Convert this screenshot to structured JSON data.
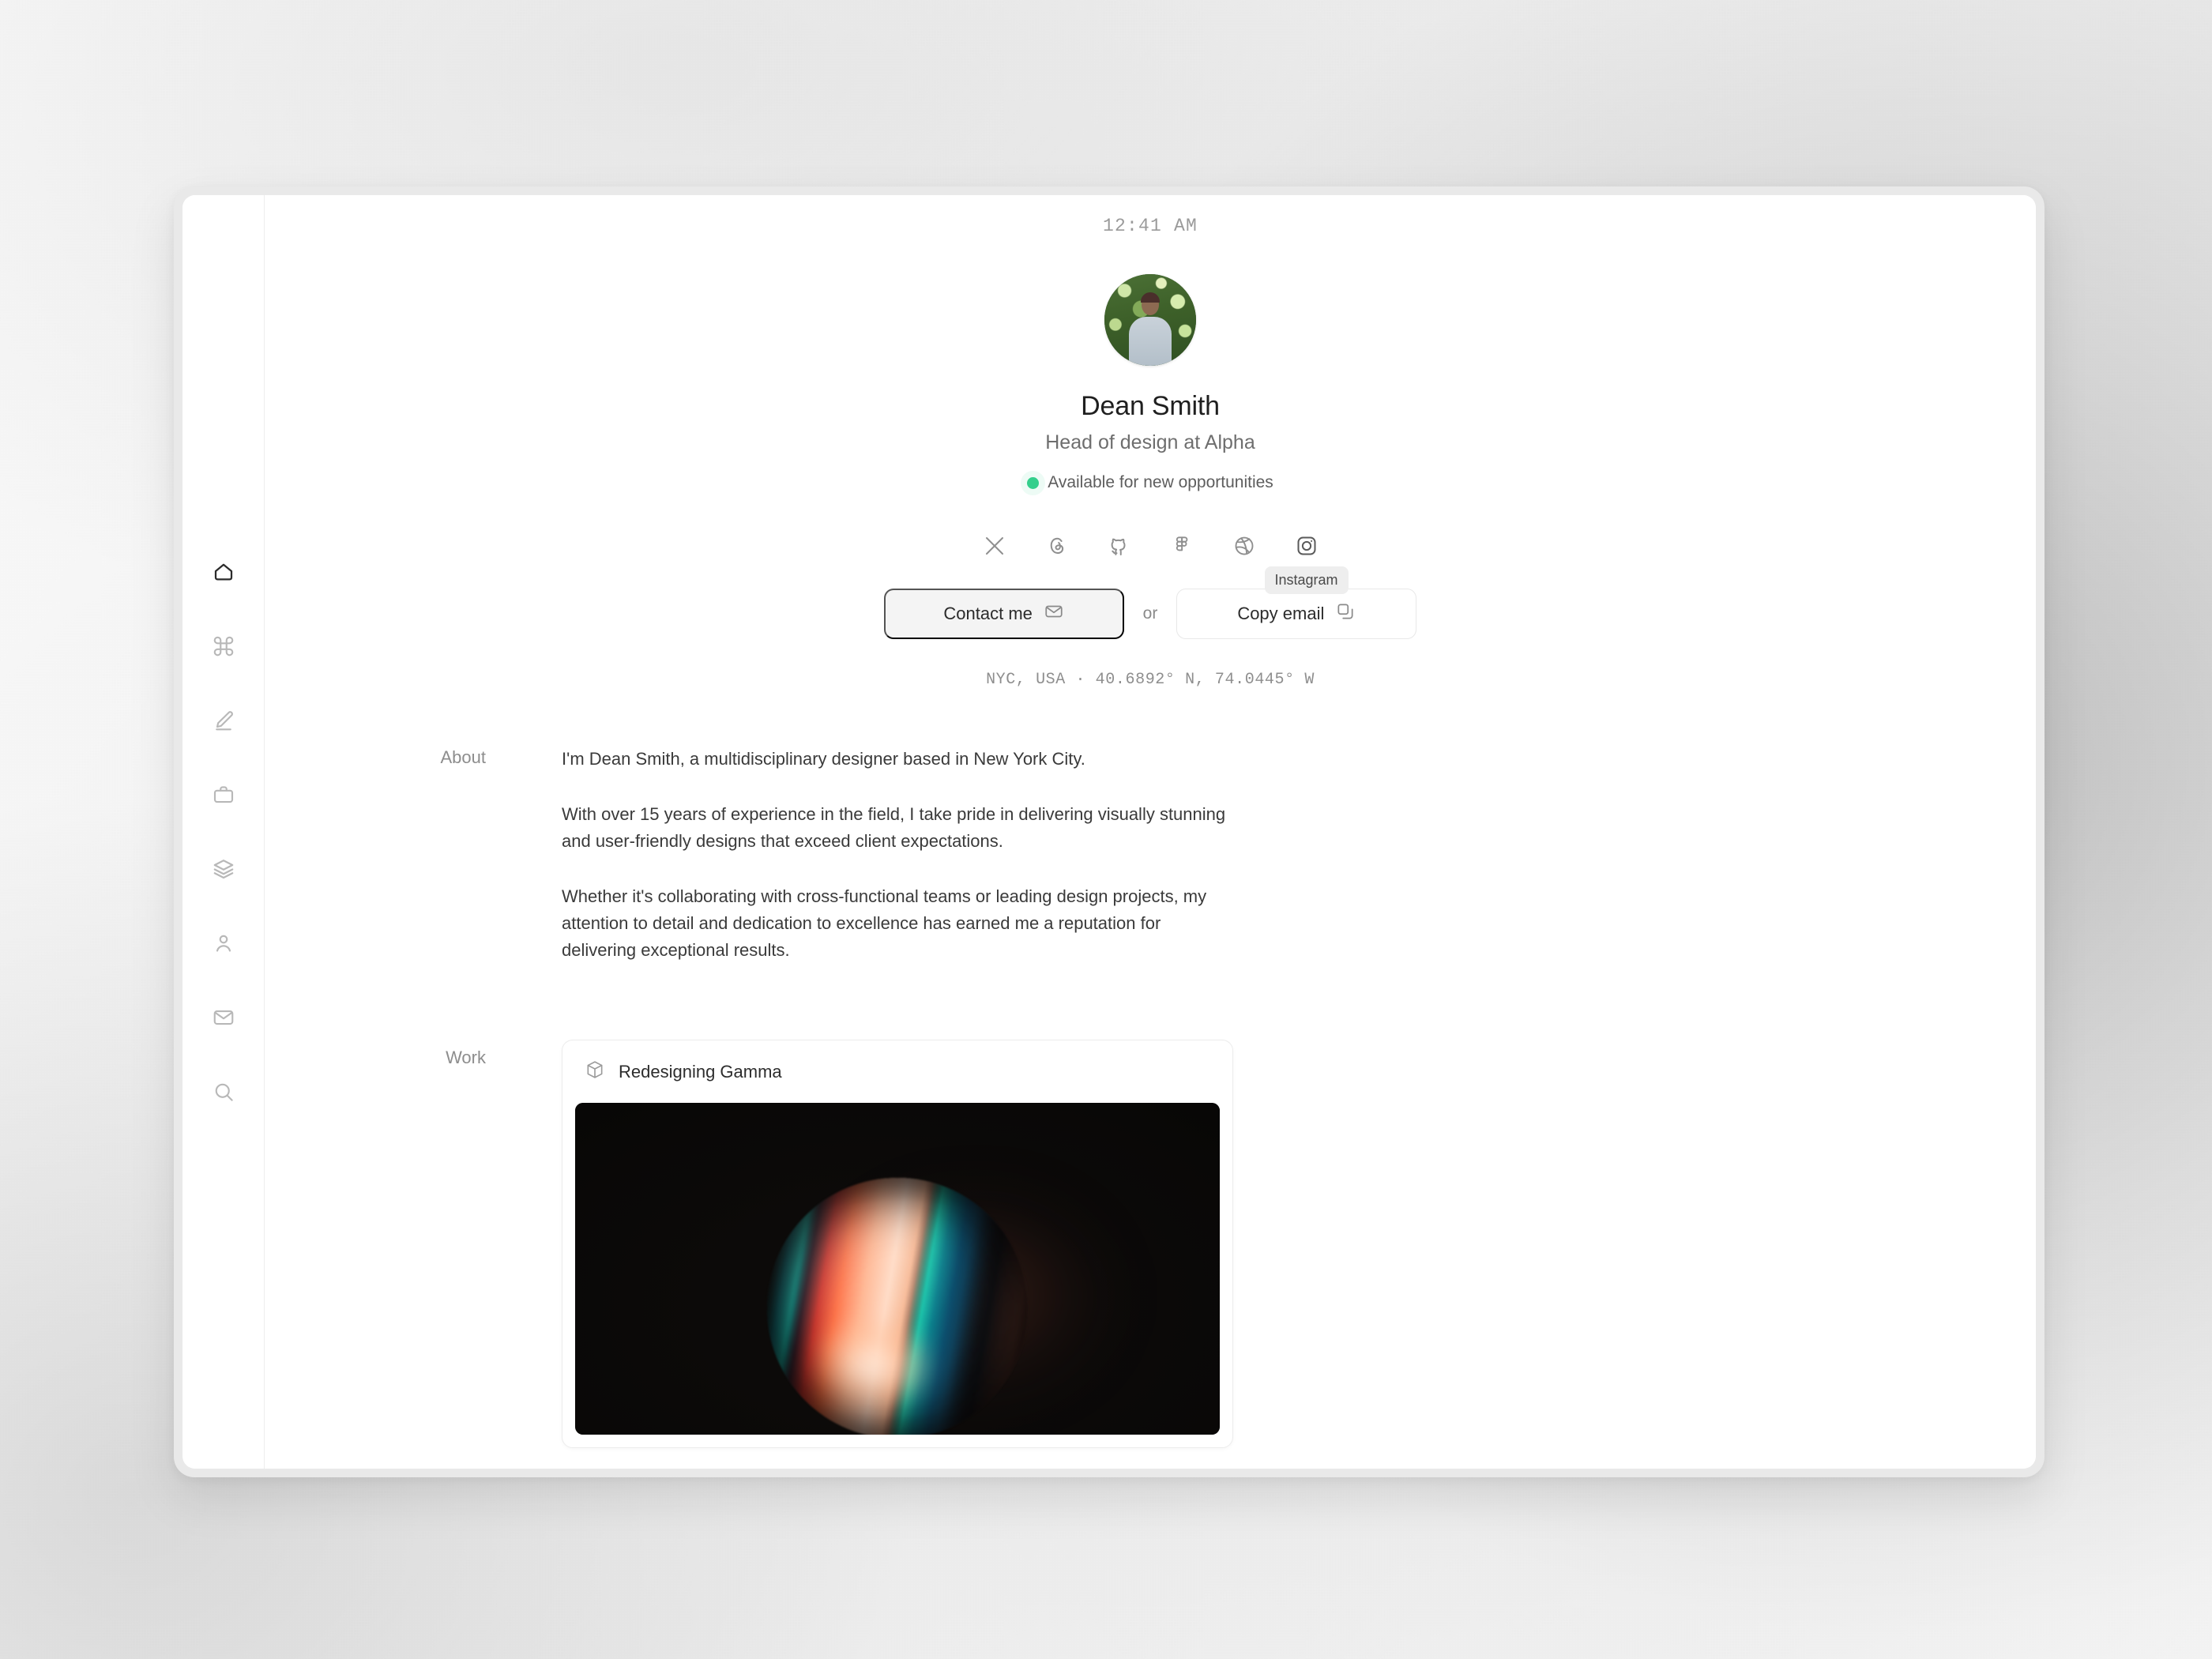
{
  "window": {
    "clock": "12:41 AM"
  },
  "sidebar": {
    "items": [
      {
        "name": "home",
        "icon": "home-icon",
        "active": true
      },
      {
        "name": "command",
        "icon": "command-icon",
        "active": false
      },
      {
        "name": "edit",
        "icon": "pen-icon",
        "active": false
      },
      {
        "name": "work",
        "icon": "briefcase-icon",
        "active": false
      },
      {
        "name": "layers",
        "icon": "layers-icon",
        "active": false
      },
      {
        "name": "profile",
        "icon": "user-icon",
        "active": false
      },
      {
        "name": "mail",
        "icon": "mail-icon",
        "active": false
      },
      {
        "name": "search",
        "icon": "search-icon",
        "active": false
      }
    ]
  },
  "profile": {
    "name": "Dean Smith",
    "role": "Head of design at Alpha",
    "status": "Available for new opportunities",
    "status_color": "#34cf8c",
    "location": "NYC, USA · 40.6892° N, 74.0445° W"
  },
  "socials": [
    {
      "label": "X",
      "icon": "x-icon"
    },
    {
      "label": "Threads",
      "icon": "threads-icon"
    },
    {
      "label": "GitHub",
      "icon": "github-icon"
    },
    {
      "label": "Figma",
      "icon": "figma-icon"
    },
    {
      "label": "Dribbble",
      "icon": "dribbble-icon"
    },
    {
      "label": "Instagram",
      "icon": "instagram-icon"
    }
  ],
  "tooltip": {
    "text": "Instagram"
  },
  "actions": {
    "contact_label": "Contact me",
    "separator": "or",
    "copy_label": "Copy email"
  },
  "about": {
    "label": "About",
    "paragraphs": [
      "I'm Dean Smith, a multidisciplinary designer based in New York City.",
      "With over 15 years of experience in the field, I take pride in delivering visually stunning and user-friendly designs that exceed client expectations.",
      "Whether it's collaborating with cross-functional teams or leading design projects, my attention to detail and dedication to excellence has earned me a reputation for delivering exceptional results."
    ]
  },
  "work": {
    "label": "Work",
    "items": [
      {
        "title": "Redesigning Gamma",
        "icon": "cube-icon"
      }
    ]
  }
}
